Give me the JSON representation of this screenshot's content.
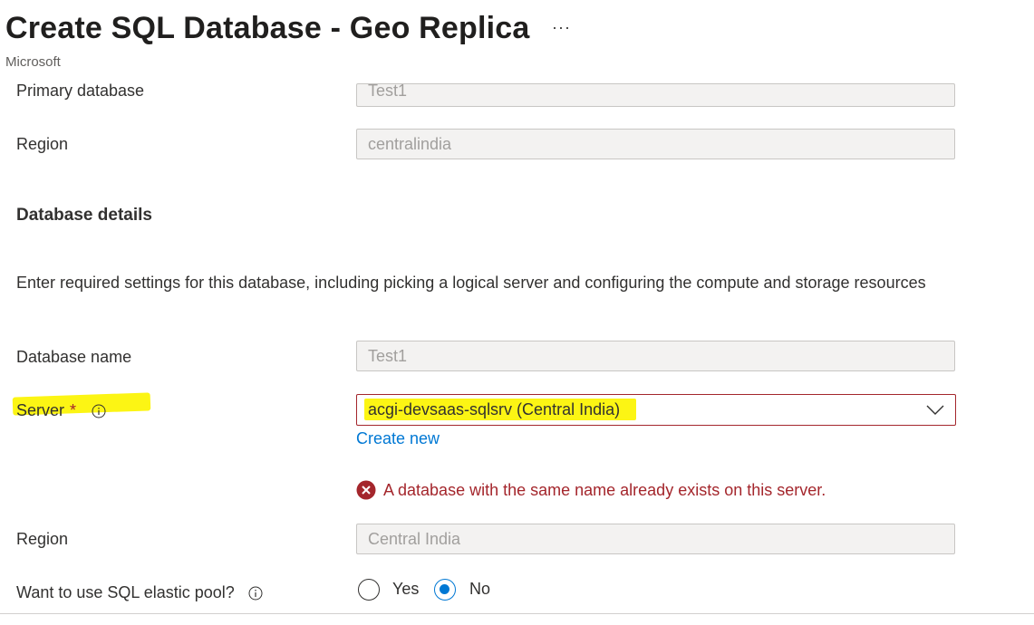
{
  "header": {
    "title": "Create SQL Database - Geo Replica",
    "more_label": "···",
    "publisher": "Microsoft"
  },
  "primary": {
    "database_label": "Primary database",
    "database_value": "Test1",
    "region_label": "Region",
    "region_value": "centralindia"
  },
  "details": {
    "heading": "Database details",
    "description": "Enter required settings for this database, including picking a logical server and configuring the compute and storage resources",
    "name_label": "Database name",
    "name_value": "Test1",
    "server_label": "Server",
    "required_mark": "*",
    "server_value": "acgi-devsaas-sqlsrv (Central India)",
    "create_new_label": "Create new",
    "error_message": "A database with the same name already exists on this server.",
    "region_label": "Region",
    "region_value": "Central India",
    "elastic_pool_label": "Want to use SQL elastic pool?",
    "elastic_pool_options": [
      "Yes",
      "No"
    ],
    "elastic_pool_selected": "No"
  },
  "icons": {
    "info": "info-icon",
    "error": "error-circle-icon",
    "chevron": "chevron-down-icon",
    "more": "more-options-icon"
  },
  "colors": {
    "accent": "#0078d4",
    "error": "#a4262c",
    "highlight": "#fcf400",
    "disabled_field_bg": "#f3f2f1"
  }
}
